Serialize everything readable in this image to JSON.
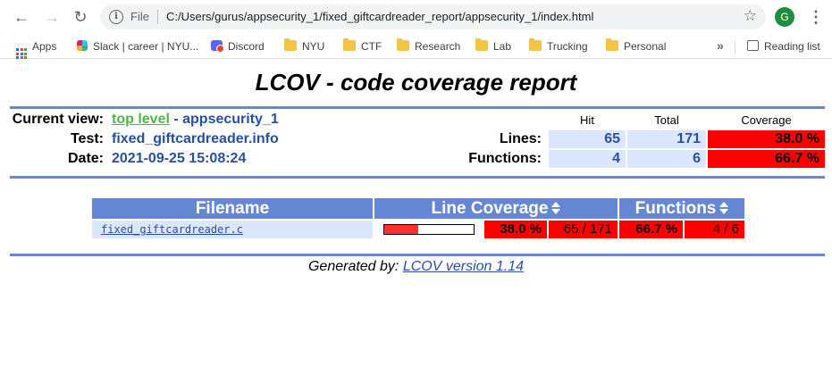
{
  "browser": {
    "url_scheme": "File",
    "url": "C:/Users/gurus/appsecurity_1/fixed_giftcardreader_report/appsecurity_1/index.html",
    "avatar_initial": "G"
  },
  "bookmarks": {
    "items": [
      {
        "label": "Apps",
        "icon": "apps-icon"
      },
      {
        "label": "Slack | career | NYU...",
        "icon": "slack-icon"
      },
      {
        "label": "Discord",
        "icon": "discord-icon"
      },
      {
        "label": "NYU",
        "icon": "folder-icon"
      },
      {
        "label": "CTF",
        "icon": "folder-icon"
      },
      {
        "label": "Research",
        "icon": "folder-icon"
      },
      {
        "label": "Lab",
        "icon": "folder-icon"
      },
      {
        "label": "Trucking",
        "icon": "folder-icon"
      },
      {
        "label": "Personal",
        "icon": "folder-icon"
      }
    ],
    "more": "»",
    "reading_list": "Reading list"
  },
  "report": {
    "title": "LCOV - code coverage report",
    "current_view_label": "Current view:",
    "top_level_link": "top level",
    "current_view_suffix": "- appsecurity_1",
    "test_label": "Test:",
    "test_value": "fixed_giftcardreader.info",
    "date_label": "Date:",
    "date_value": "2021-09-25 15:08:24",
    "stats": {
      "col_hit": "Hit",
      "col_total": "Total",
      "col_coverage": "Coverage",
      "lines_label": "Lines:",
      "lines_hit": "65",
      "lines_total": "171",
      "lines_coverage": "38.0 %",
      "functions_label": "Functions:",
      "functions_hit": "4",
      "functions_total": "6",
      "functions_coverage": "66.7 %"
    }
  },
  "table": {
    "headers": {
      "filename": "Filename",
      "line_coverage": "Line Coverage",
      "functions": "Functions"
    },
    "rows": [
      {
        "filename": "fixed_giftcardreader.c",
        "line_fraction": 0.38,
        "line_percent": "38.0 %",
        "line_count": "65 / 171",
        "func_percent": "66.7 %",
        "func_count": "4 / 6"
      }
    ]
  },
  "footer": {
    "prefix": "Generated by:",
    "link": "LCOV version 1.14"
  },
  "colors": {
    "accent": "#6688d4",
    "low_coverage": "#ff0000",
    "cell_blue": "#dae7fe",
    "text_blue": "#284fa8",
    "link_green": "#4cb848"
  }
}
